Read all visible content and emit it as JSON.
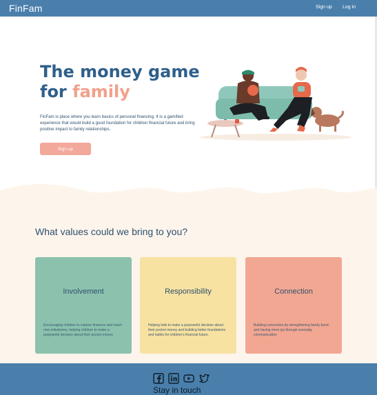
{
  "header": {
    "logo": "FinFam",
    "nav": {
      "signup": "Sign up",
      "login": "Log in"
    }
  },
  "hero": {
    "title_line1": "The money game",
    "title_for": "for ",
    "title_accent": "family",
    "description": "FinFam is place where you learn basics of personal financing. It is a gamified experience that would build a good foundation for children financial future and bring positive impact to family relationships.",
    "cta": "Sign up"
  },
  "values": {
    "title": "What values could we bring to you?",
    "cards": [
      {
        "title": "Involvement",
        "text": "Encouraging children to explore finances and reach new milestones, helping children to make a purposeful decision about their pocket money."
      },
      {
        "title": "Responsibility",
        "text": "Helping kids to make a purposeful decision about their pocket money and building better foundations and habits for children's financial future."
      },
      {
        "title": "Connection",
        "text": "Building connection by strengthening family bond and having more joy through everyday communication"
      }
    ]
  },
  "footer": {
    "social": [
      "facebook-icon",
      "linkedin-icon",
      "youtube-icon",
      "twitter-icon"
    ],
    "stay_in_touch": "Stay in touch"
  },
  "colors": {
    "primary": "#4a7fab",
    "title_blue": "#2e5f8a",
    "accent_peach": "#f2a08a",
    "card_green": "#8cc2ad",
    "card_yellow": "#f7e2a2",
    "card_salmon": "#f2a792",
    "cream": "#fdf5ec"
  }
}
